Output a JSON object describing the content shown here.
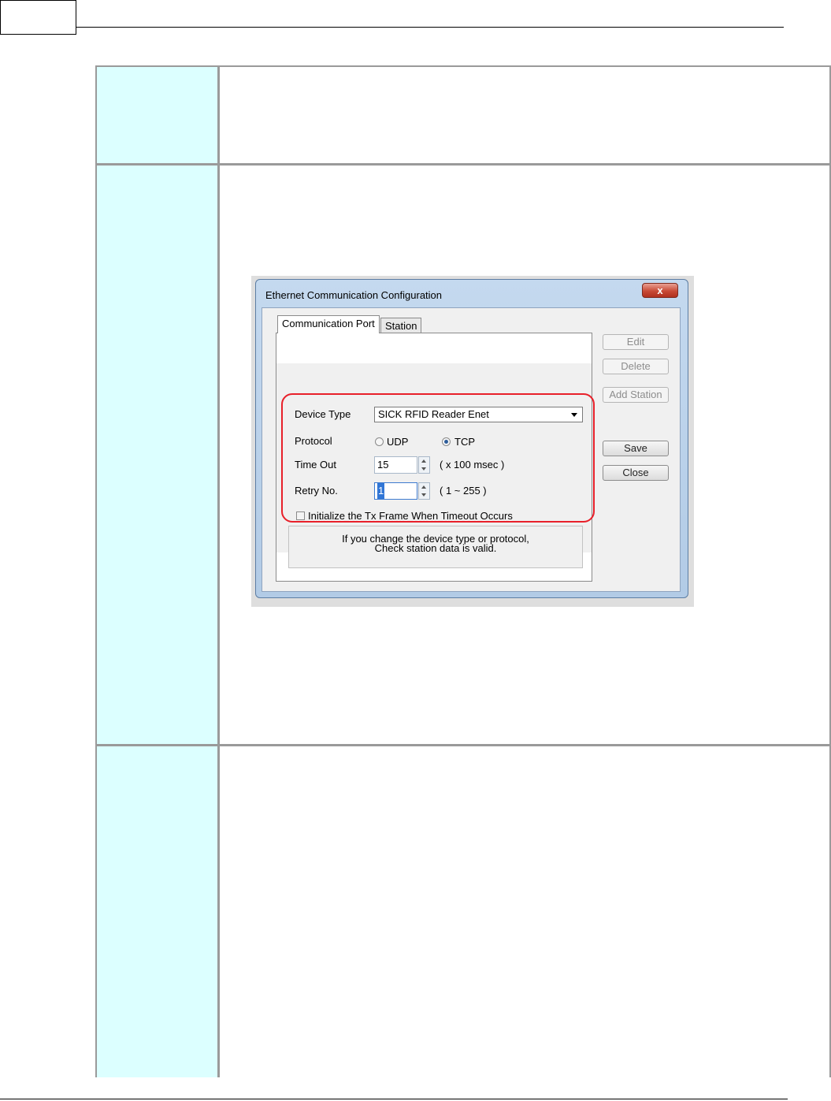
{
  "dialog": {
    "title": "Ethernet Communication Configuration",
    "close_glyph": "x",
    "tabs": [
      {
        "label": "Communication Port",
        "selected": true
      },
      {
        "label": "Station",
        "selected": false
      }
    ],
    "buttons": {
      "edit": "Edit",
      "delete": "Delete",
      "add_station": "Add Station",
      "save": "Save",
      "close": "Close"
    },
    "device_type": {
      "label": "Device Type",
      "value": "SICK RFID Reader Enet"
    },
    "protocol": {
      "label": "Protocol",
      "options": [
        {
          "label": "UDP",
          "checked": false
        },
        {
          "label": "TCP",
          "checked": true
        }
      ]
    },
    "time_out": {
      "label": "Time Out",
      "value": "15",
      "unit": "( x 100 msec )"
    },
    "retry_no": {
      "label": "Retry No.",
      "value": "1",
      "range": "( 1 ~ 255 )"
    },
    "init_tx": {
      "label": "Initialize the Tx Frame When Timeout  Occurs",
      "checked": false
    },
    "note": {
      "line1": "If you change the device type or protocol,",
      "line2": "Check station data is valid."
    }
  },
  "colors": {
    "label_cell_bg": "#dcffff",
    "table_border": "#9a9a9a",
    "highlight_red": "#e8202a",
    "dialog_frame": "#b2cbe6"
  }
}
